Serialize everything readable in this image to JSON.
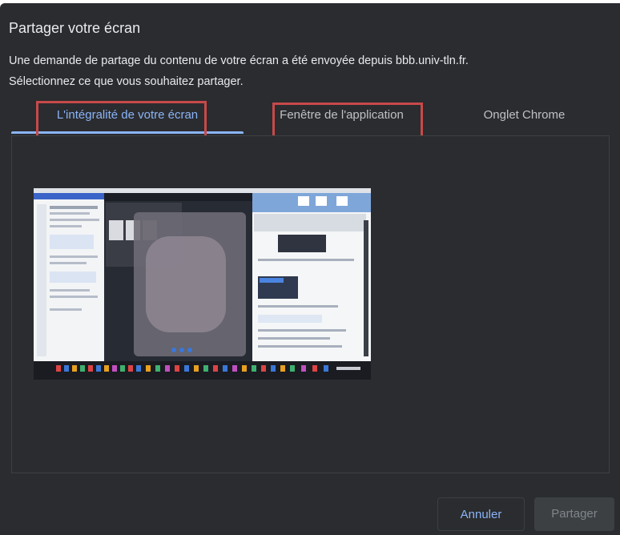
{
  "dialog": {
    "title": "Partager votre écran",
    "description_line1": "Une demande de partage du contenu de votre écran a été envoyée depuis bbb.univ-tln.fr.",
    "description_line2": "Sélectionnez ce que vous souhaitez partager."
  },
  "tabs": [
    {
      "label": "L'intégralité de votre écran",
      "active": true
    },
    {
      "label": "Fenêtre de l'application",
      "active": false
    },
    {
      "label": "Onglet Chrome",
      "active": false
    }
  ],
  "colors": {
    "accent": "#8ab4f8",
    "highlight_box": "#c8494a",
    "dialog_bg": "#2b2c2f"
  },
  "footer": {
    "cancel_label": "Annuler",
    "share_label": "Partager"
  }
}
